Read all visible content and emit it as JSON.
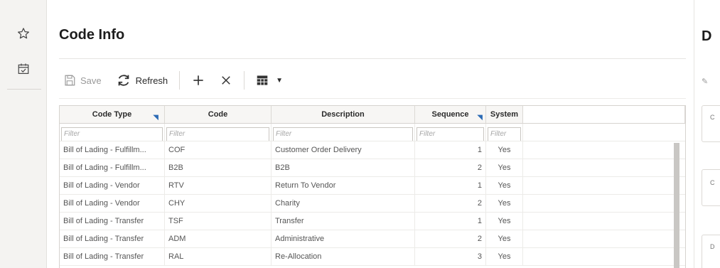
{
  "rail": {
    "favorite_icon": "star-outline-icon",
    "tasks_icon": "calendar-check-icon"
  },
  "page": {
    "title": "Code Info"
  },
  "toolbar": {
    "save_label": "Save",
    "refresh_label": "Refresh",
    "add_icon": "plus-icon",
    "delete_icon": "close-icon",
    "columns_icon": "table-icon"
  },
  "grid": {
    "columns": [
      "Code Type",
      "Code",
      "Description",
      "Sequence",
      "System"
    ],
    "filter_placeholder": "Filter",
    "rows": [
      {
        "code_type": "Bill of Lading - Fulfillm...",
        "code": "COF",
        "description": "Customer Order Delivery",
        "sequence": "1",
        "system": "Yes"
      },
      {
        "code_type": "Bill of Lading - Fulfillm...",
        "code": "B2B",
        "description": "B2B",
        "sequence": "2",
        "system": "Yes"
      },
      {
        "code_type": "Bill of Lading - Vendor",
        "code": "RTV",
        "description": "Return To Vendor",
        "sequence": "1",
        "system": "Yes"
      },
      {
        "code_type": "Bill of Lading - Vendor",
        "code": "CHY",
        "description": "Charity",
        "sequence": "2",
        "system": "Yes"
      },
      {
        "code_type": "Bill of Lading - Transfer",
        "code": "TSF",
        "description": "Transfer",
        "sequence": "1",
        "system": "Yes"
      },
      {
        "code_type": "Bill of Lading - Transfer",
        "code": "ADM",
        "description": "Administrative",
        "sequence": "2",
        "system": "Yes"
      },
      {
        "code_type": "Bill of Lading - Transfer",
        "code": "RAL",
        "description": "Re-Allocation",
        "sequence": "3",
        "system": "Yes"
      }
    ]
  },
  "right_panel": {
    "title": "D",
    "labels": [
      "C",
      "C",
      "D"
    ]
  },
  "colors": {
    "sort_indicator": "#2c6bb5",
    "rail_bg": "#f4f3f1"
  }
}
